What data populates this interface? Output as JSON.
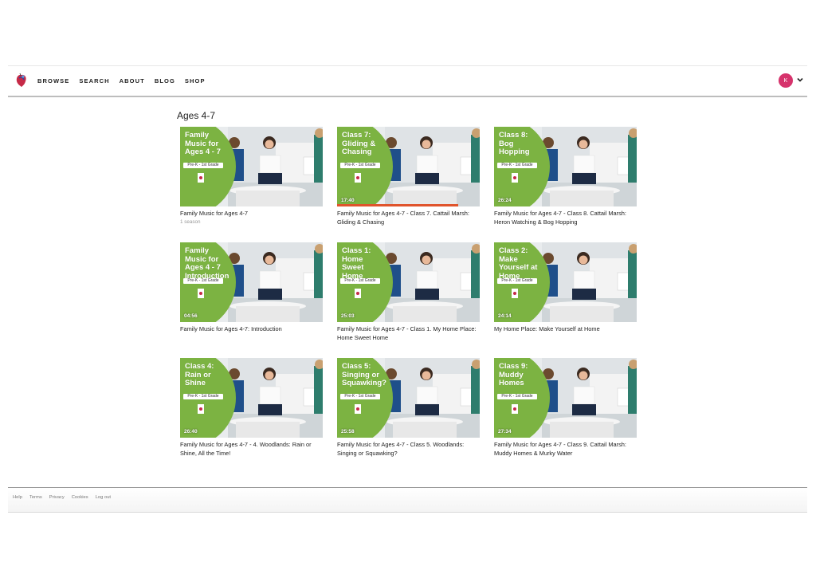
{
  "nav": {
    "items": [
      "BROWSE",
      "SEARCH",
      "ABOUT",
      "BLOG",
      "SHOP"
    ]
  },
  "user": {
    "initial": "K"
  },
  "section": {
    "title": "Ages 4-7"
  },
  "cards": [
    {
      "thumb_title": "Family Music for Ages 4 - 7",
      "grade": "Pre-K - 1st Grade",
      "duration": "",
      "progress": 0,
      "title": "Family Music for Ages 4-7",
      "subtitle": "1 season"
    },
    {
      "thumb_title": "Class 7: Gliding & Chasing",
      "grade": "Pre-K - 1st Grade",
      "duration": "17:40",
      "progress": 0.85,
      "title": "Family Music for Ages 4-7 - Class 7. Cattail Marsh: Gliding & Chasing",
      "subtitle": ""
    },
    {
      "thumb_title": "Class 8: Bog Hopping",
      "grade": "Pre-K - 1st Grade",
      "duration": "26:24",
      "progress": 0,
      "title": "Family Music for Ages 4-7 - Class 8. Cattail Marsh: Heron Watching & Bog Hopping",
      "subtitle": ""
    },
    {
      "thumb_title": "Family Music for Ages 4 - 7 Introduction",
      "grade": "Pre-K - 1st Grade",
      "duration": "04:56",
      "progress": 0,
      "title": "Family Music for Ages 4-7: Introduction",
      "subtitle": ""
    },
    {
      "thumb_title": "Class 1: Home Sweet Home",
      "grade": "Pre-K - 1st Grade",
      "duration": "25:03",
      "progress": 0,
      "title": "Family Music for Ages 4-7 - Class 1. My Home Place: Home Sweet Home",
      "subtitle": ""
    },
    {
      "thumb_title": "Class 2: Make Yourself at Home",
      "grade": "Pre-K - 1st Grade",
      "duration": "24:14",
      "progress": 0,
      "title": "My Home Place: Make Yourself at Home",
      "subtitle": ""
    },
    {
      "thumb_title": "Class 4: Rain or Shine",
      "grade": "Pre-K - 1st Grade",
      "duration": "26:40",
      "progress": 0,
      "title": "Family Music for Ages 4-7 - 4. Woodlands: Rain or Shine, All the Time!",
      "subtitle": ""
    },
    {
      "thumb_title": "Class 5: Singing or Squawking?",
      "grade": "Pre-K - 1st Grade",
      "duration": "25:58",
      "progress": 0,
      "title": "Family Music for Ages 4-7 - Class 5. Woodlands: Singing or Squawking?",
      "subtitle": ""
    },
    {
      "thumb_title": "Class 9: Muddy Homes",
      "grade": "Pre-K - 1st Grade",
      "duration": "27:34",
      "progress": 0,
      "title": "Family Music for Ages 4-7 - Class 9. Cattail Marsh: Muddy Homes & Murky Water",
      "subtitle": ""
    }
  ],
  "footer": {
    "links": [
      "Help",
      "Terms",
      "Privacy",
      "Cookies",
      "Log out"
    ]
  },
  "colors": {
    "accent": "#d6336c",
    "thumb_green": "#7cb342",
    "progress": "#e0542c"
  }
}
